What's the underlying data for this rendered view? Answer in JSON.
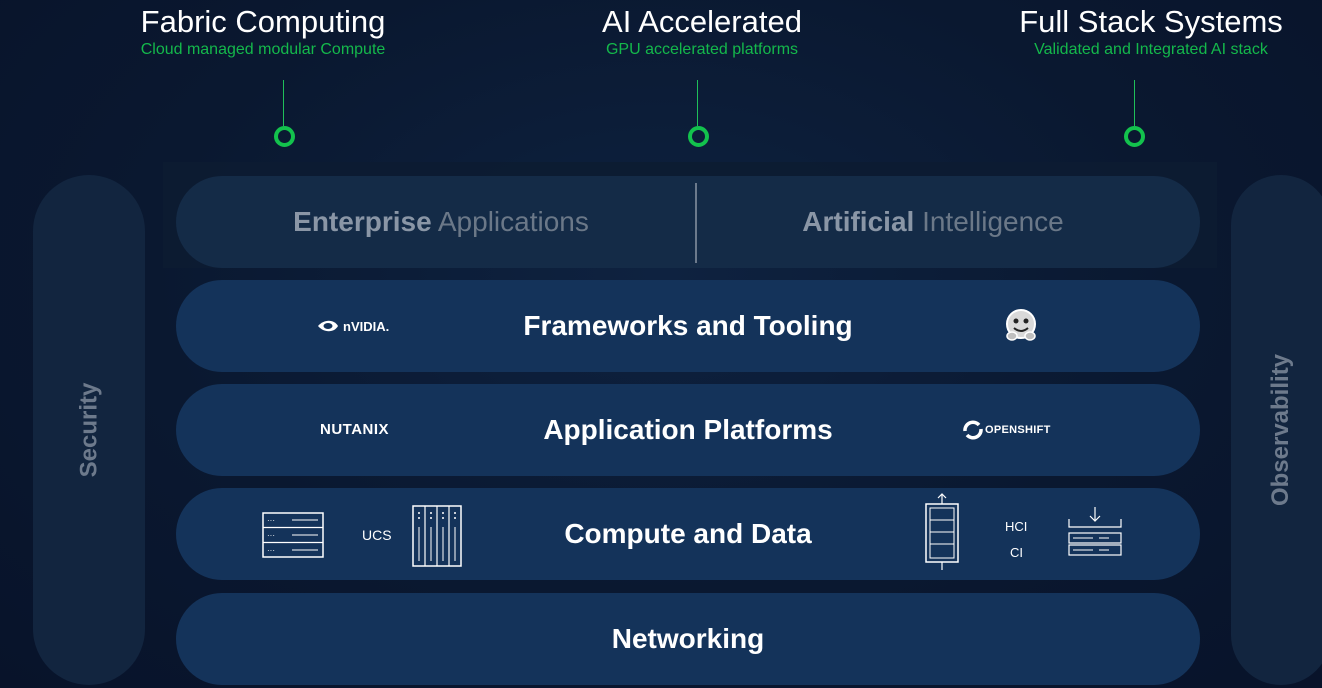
{
  "callouts": [
    {
      "title": "Fabric Computing",
      "subtitle": "Cloud managed modular Compute"
    },
    {
      "title": "AI Accelerated",
      "subtitle": "GPU accelerated platforms"
    },
    {
      "title": "Full Stack Systems",
      "subtitle": "Validated and Integrated AI stack"
    }
  ],
  "sides": {
    "left": "Security",
    "right": "Observability"
  },
  "top_layer": {
    "left": {
      "bold": "Enterprise",
      "light": "Applications"
    },
    "right": {
      "bold": "Artificial",
      "light": "Intelligence"
    }
  },
  "layers": [
    {
      "title": "Frameworks and Tooling",
      "left_logo": "nvidia",
      "right_logo": "hugging-face-icon"
    },
    {
      "title": "Application Platforms",
      "left_logo": "NUTANIX",
      "right_logo": "OPENSHIFT"
    },
    {
      "title": "Compute and Data",
      "left_label": "UCS",
      "right_labels": [
        "HCI",
        "CI"
      ]
    },
    {
      "title": "Networking"
    }
  ],
  "colors": {
    "accent_green": "#13c24d",
    "layer_fill": "#14335a",
    "background": "#0a1830"
  }
}
